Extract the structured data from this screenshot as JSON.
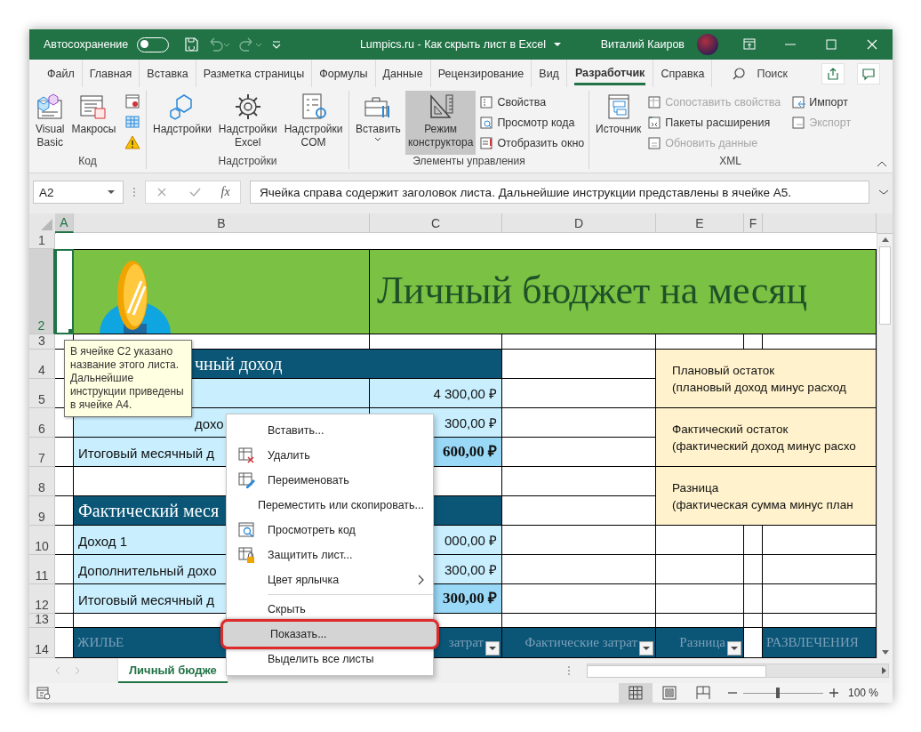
{
  "title_bar": {
    "autosave_label": "Автосохранение",
    "autosave_on": false,
    "title": "Lumpics.ru - Как скрыть лист в Excel",
    "user": "Виталий Каиров"
  },
  "ribbon_tabs": [
    {
      "label": "Файл",
      "selected": false
    },
    {
      "label": "Главная",
      "selected": false
    },
    {
      "label": "Вставка",
      "selected": false
    },
    {
      "label": "Разметка страницы",
      "selected": false
    },
    {
      "label": "Формулы",
      "selected": false
    },
    {
      "label": "Данные",
      "selected": false
    },
    {
      "label": "Рецензирование",
      "selected": false
    },
    {
      "label": "Вид",
      "selected": false
    },
    {
      "label": "Разработчик",
      "selected": true
    },
    {
      "label": "Справка",
      "selected": false
    }
  ],
  "search": {
    "placeholder": "Поиск"
  },
  "ribbon_groups": [
    {
      "label": "Код",
      "large": [
        {
          "label": "Visual\nBasic",
          "on": false,
          "dropdown": false
        },
        {
          "label": "Макросы",
          "on": false,
          "dropdown": false
        }
      ]
    },
    {
      "label": "Надстройки",
      "large": [
        {
          "label": "Надстройки",
          "on": false,
          "dropdown": false
        },
        {
          "label": "Надстройки\nExcel",
          "on": false,
          "dropdown": false
        },
        {
          "label": "Надстройки\nCOM",
          "on": false,
          "dropdown": false
        }
      ]
    },
    {
      "label": "Элементы управления",
      "large": [
        {
          "label": "Вставить",
          "on": false,
          "dropdown": true
        },
        {
          "label": "Режим\nконструктора",
          "on": true,
          "dropdown": false
        }
      ],
      "small": [
        {
          "label": "Свойства",
          "disabled": false
        },
        {
          "label": "Просмотр кода",
          "disabled": false
        },
        {
          "label": "Отобразить окно",
          "disabled": false
        }
      ]
    },
    {
      "label": "XML",
      "large": [
        {
          "label": "Источник",
          "on": false,
          "dropdown": false
        }
      ],
      "small": [
        {
          "label": "Сопоставить свойства",
          "disabled": true
        },
        {
          "label": "Пакеты расширения",
          "disabled": false
        },
        {
          "label": "Обновить данные",
          "disabled": true
        },
        {
          "label": "Импорт",
          "disabled": false
        },
        {
          "label": "Экспорт",
          "disabled": true
        }
      ]
    }
  ],
  "formula_bar": {
    "name_box": "A2",
    "function_label": "fx",
    "formula": "Ячейка справа содержит заголовок листа. Дальнейшие инструкции представлены в ячейке A5."
  },
  "sheet": {
    "columns": [
      {
        "label": "A",
        "selected": true
      },
      {
        "label": "B",
        "selected": false
      },
      {
        "label": "C",
        "selected": false
      },
      {
        "label": "D",
        "selected": false
      },
      {
        "label": "E",
        "selected": false
      },
      {
        "label": "F",
        "selected": false
      }
    ],
    "rows": [
      {
        "label": "1",
        "selected": false
      },
      {
        "label": "2",
        "selected": true,
        "cells": [
          {
            "kind": "empty"
          },
          {
            "kind": "logo"
          },
          {
            "kind": "title",
            "text": "Личный бюджет на месяц"
          },
          {
            "kind": "merged"
          },
          {
            "kind": "merged"
          },
          {
            "kind": "merged"
          },
          {
            "kind": "merged"
          }
        ]
      },
      {
        "label": "3",
        "selected": false,
        "cells": [
          {
            "kind": "empty"
          },
          {
            "kind": "empty"
          },
          {
            "kind": "empty"
          },
          {
            "kind": "empty"
          },
          {
            "kind": "empty"
          },
          {
            "kind": "empty"
          },
          {
            "kind": "empty"
          }
        ]
      },
      {
        "label": "4",
        "selected": false,
        "cells": [
          {
            "kind": "empty"
          },
          {
            "kind": "section",
            "text": "чный доход"
          },
          {
            "kind": "merged"
          },
          {
            "kind": "empty"
          },
          {
            "kind": "note",
            "lines": [
              "Плановый остаток",
              "(плановый доход минус расход"
            ]
          },
          {
            "kind": "merged"
          },
          {
            "kind": "merged"
          }
        ]
      },
      {
        "label": "5",
        "selected": false,
        "cells": [
          {
            "kind": "empty"
          },
          {
            "kind": "label"
          },
          {
            "kind": "amount",
            "text": "4 300,00 ₽"
          },
          {
            "kind": "empty"
          },
          {
            "kind": "merged_up"
          },
          {
            "kind": "merged_up"
          },
          {
            "kind": "merged_up"
          }
        ]
      },
      {
        "label": "6",
        "selected": false,
        "cells": [
          {
            "kind": "empty"
          },
          {
            "kind": "label",
            "text": "дохо"
          },
          {
            "kind": "amount",
            "text": "300,00 ₽"
          },
          {
            "kind": "empty"
          },
          {
            "kind": "note",
            "lines": [
              "Фактический остаток",
              "(фактический доход минус расхо"
            ]
          },
          {
            "kind": "merged"
          },
          {
            "kind": "merged"
          }
        ]
      },
      {
        "label": "7",
        "selected": false,
        "cells": [
          {
            "kind": "empty"
          },
          {
            "kind": "label",
            "text": "Итоговый месячный д"
          },
          {
            "kind": "total",
            "text": "600,00 ₽"
          },
          {
            "kind": "empty"
          },
          {
            "kind": "merged_up"
          },
          {
            "kind": "merged_up"
          },
          {
            "kind": "merged_up"
          }
        ]
      },
      {
        "label": "8",
        "selected": false,
        "cells": [
          {
            "kind": "empty"
          },
          {
            "kind": "empty"
          },
          {
            "kind": "empty"
          },
          {
            "kind": "empty"
          },
          {
            "kind": "note",
            "lines": [
              "Разница",
              "(фактическая сумма минус план"
            ]
          },
          {
            "kind": "merged"
          },
          {
            "kind": "merged"
          }
        ]
      },
      {
        "label": "9",
        "selected": false,
        "cells": [
          {
            "kind": "empty"
          },
          {
            "kind": "section",
            "text": "Фактический меся"
          },
          {
            "kind": "merged"
          },
          {
            "kind": "empty"
          },
          {
            "kind": "merged_up"
          },
          {
            "kind": "merged_up"
          },
          {
            "kind": "merged_up"
          }
        ]
      },
      {
        "label": "10",
        "selected": false,
        "cells": [
          {
            "kind": "empty"
          },
          {
            "kind": "label",
            "text": "Доход 1"
          },
          {
            "kind": "amount",
            "text": "000,00 ₽"
          },
          {
            "kind": "empty"
          },
          {
            "kind": "empty"
          },
          {
            "kind": "empty"
          },
          {
            "kind": "empty"
          }
        ]
      },
      {
        "label": "11",
        "selected": false,
        "cells": [
          {
            "kind": "empty"
          },
          {
            "kind": "label",
            "text": "Дополнительный дохо"
          },
          {
            "kind": "amount",
            "text": "300,00 ₽"
          },
          {
            "kind": "empty"
          },
          {
            "kind": "empty"
          },
          {
            "kind": "empty"
          },
          {
            "kind": "empty"
          }
        ]
      },
      {
        "label": "12",
        "selected": false,
        "cells": [
          {
            "kind": "empty"
          },
          {
            "kind": "label",
            "text": "Итоговый месячный д"
          },
          {
            "kind": "total",
            "text": "300,00 ₽"
          },
          {
            "kind": "empty"
          },
          {
            "kind": "empty"
          },
          {
            "kind": "empty"
          },
          {
            "kind": "empty"
          }
        ]
      },
      {
        "label": "13",
        "selected": false,
        "cells": [
          {
            "kind": "empty"
          },
          {
            "kind": "empty"
          },
          {
            "kind": "empty"
          },
          {
            "kind": "empty"
          },
          {
            "kind": "empty"
          },
          {
            "kind": "empty"
          },
          {
            "kind": "empty"
          }
        ]
      },
      {
        "label": "14",
        "selected": false,
        "cells": [
          {
            "kind": "empty"
          },
          {
            "kind": "table_header",
            "text": "ЖИЛЬЕ",
            "filter": false
          },
          {
            "kind": "table_header",
            "text": "затрат",
            "filter": true
          },
          {
            "kind": "table_header",
            "text": "Фактические затрат",
            "filter": true
          },
          {
            "kind": "table_header",
            "text": "Разница",
            "filter": true
          },
          {
            "kind": "empty"
          },
          {
            "kind": "table_header",
            "text": "РАЗВЛЕЧЕНИЯ",
            "filter": false
          }
        ]
      }
    ],
    "comment": {
      "text": "В ячейке C2 указано название этого листа. Дальнейшие инструкции приведены в ячейке A4."
    }
  },
  "context_menu": [
    {
      "kind": "item",
      "label": "Вставить...",
      "selected": false
    },
    {
      "kind": "item",
      "label": "Удалить",
      "selected": false
    },
    {
      "kind": "item",
      "label": "Переименовать",
      "selected": false
    },
    {
      "kind": "item",
      "label": "Переместить или скопировать...",
      "selected": false
    },
    {
      "kind": "item",
      "label": "Просмотреть код",
      "selected": false
    },
    {
      "kind": "item",
      "label": "Защитить лист...",
      "selected": false
    },
    {
      "kind": "submenu",
      "label": "Цвет ярлычка",
      "selected": false
    },
    {
      "kind": "separator"
    },
    {
      "kind": "item",
      "label": "Скрыть",
      "selected": false
    },
    {
      "kind": "item",
      "label": "Показать...",
      "selected": true
    },
    {
      "kind": "item",
      "label": "Выделить все листы",
      "selected": false
    }
  ],
  "sheet_tabs": [
    {
      "label": "Личный бюдже",
      "selected": true
    }
  ],
  "status_bar": {
    "views": [
      {
        "selected": true
      },
      {
        "selected": false
      },
      {
        "selected": false
      }
    ],
    "zoom": {
      "level": 0.43,
      "reading": "100 %"
    }
  }
}
